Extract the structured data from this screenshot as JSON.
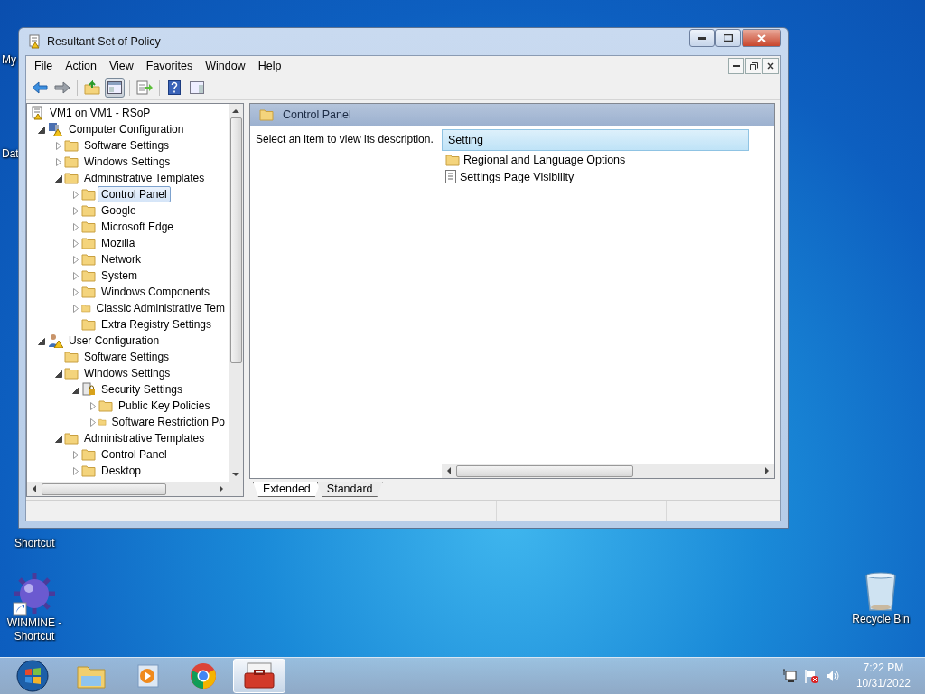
{
  "desktop_icons": [
    {
      "label": "My"
    },
    {
      "label": "Dat"
    },
    {
      "label": "Shortcut"
    },
    {
      "label": "WINMINE - Shortcut",
      "kind": "mine"
    },
    {
      "label": "Recycle Bin",
      "kind": "bin"
    }
  ],
  "window": {
    "title": "Resultant Set of Policy"
  },
  "menu": [
    "File",
    "Action",
    "View",
    "Favorites",
    "Window",
    "Help"
  ],
  "toolbar": [
    {
      "kind": "back",
      "pressed": false
    },
    {
      "kind": "forward",
      "pressed": false
    },
    {
      "kind": "up",
      "pressed": false
    },
    {
      "kind": "tree",
      "pressed": true
    },
    {
      "kind": "export",
      "pressed": false
    },
    {
      "kind": "help",
      "pressed": false
    },
    {
      "kind": "pane",
      "pressed": false
    }
  ],
  "tree": [
    {
      "label": "VM1 on VM1 - RSoP",
      "kind": "rsop",
      "expandable": false,
      "selected": false,
      "children": [
        {
          "label": "Computer Configuration",
          "kind": "computer",
          "expandable": true,
          "expanded": true,
          "selected": false,
          "children": [
            {
              "label": "Software Settings",
              "kind": "folder",
              "expandable": true,
              "expanded": false,
              "selected": false
            },
            {
              "label": "Windows Settings",
              "kind": "folder",
              "expandable": true,
              "expanded": false,
              "selected": false
            },
            {
              "label": "Administrative Templates",
              "kind": "folder",
              "expandable": true,
              "expanded": true,
              "selected": false,
              "children": [
                {
                  "label": "Control Panel",
                  "kind": "folder",
                  "expandable": true,
                  "expanded": false,
                  "selected": true
                },
                {
                  "label": "Google",
                  "kind": "folder",
                  "expandable": true,
                  "expanded": false,
                  "selected": false
                },
                {
                  "label": "Microsoft Edge",
                  "kind": "folder",
                  "expandable": true,
                  "expanded": false,
                  "selected": false
                },
                {
                  "label": "Mozilla",
                  "kind": "folder",
                  "expandable": true,
                  "expanded": false,
                  "selected": false
                },
                {
                  "label": "Network",
                  "kind": "folder",
                  "expandable": true,
                  "expanded": false,
                  "selected": false
                },
                {
                  "label": "System",
                  "kind": "folder",
                  "expandable": true,
                  "expanded": false,
                  "selected": false
                },
                {
                  "label": "Windows Components",
                  "kind": "folder",
                  "expandable": true,
                  "expanded": false,
                  "selected": false
                },
                {
                  "label": "Classic Administrative Tem",
                  "kind": "folder",
                  "expandable": true,
                  "expanded": false,
                  "selected": false
                },
                {
                  "label": "Extra Registry Settings",
                  "kind": "folder",
                  "expandable": false,
                  "selected": false
                }
              ]
            }
          ]
        },
        {
          "label": "User Configuration",
          "kind": "user",
          "expandable": true,
          "expanded": true,
          "selected": false,
          "children": [
            {
              "label": "Software Settings",
              "kind": "folder",
              "expandable": false,
              "selected": false
            },
            {
              "label": "Windows Settings",
              "kind": "folder",
              "expandable": true,
              "expanded": true,
              "selected": false,
              "children": [
                {
                  "label": "Security Settings",
                  "kind": "security",
                  "expandable": true,
                  "expanded": true,
                  "selected": false,
                  "children": [
                    {
                      "label": "Public Key Policies",
                      "kind": "folder",
                      "expandable": true,
                      "expanded": false,
                      "selected": false
                    },
                    {
                      "label": "Software Restriction Po",
                      "kind": "folder",
                      "expandable": true,
                      "expanded": false,
                      "selected": false
                    }
                  ]
                }
              ]
            },
            {
              "label": "Administrative Templates",
              "kind": "folder",
              "expandable": true,
              "expanded": true,
              "selected": false,
              "children": [
                {
                  "label": "Control Panel",
                  "kind": "folder",
                  "expandable": true,
                  "expanded": false,
                  "selected": false
                },
                {
                  "label": "Desktop",
                  "kind": "folder",
                  "expandable": true,
                  "expanded": false,
                  "selected": false
                }
              ]
            }
          ]
        }
      ]
    }
  ],
  "details": {
    "header": "Control Panel",
    "description": "Select an item to view its description.",
    "column": "Setting",
    "items": [
      {
        "label": "Regional and Language Options",
        "kind": "folder"
      },
      {
        "label": "Settings Page Visibility",
        "kind": "setting"
      }
    ]
  },
  "tabs": [
    {
      "label": "Extended",
      "selected": true
    },
    {
      "label": "Standard",
      "selected": false
    }
  ],
  "taskbar": [
    {
      "kind": "explorer",
      "active": false
    },
    {
      "kind": "media",
      "active": false
    },
    {
      "kind": "chrome",
      "active": false
    },
    {
      "kind": "rsop",
      "active": true
    }
  ],
  "clock": {
    "time": "7:22 PM",
    "date": "10/31/2022"
  }
}
